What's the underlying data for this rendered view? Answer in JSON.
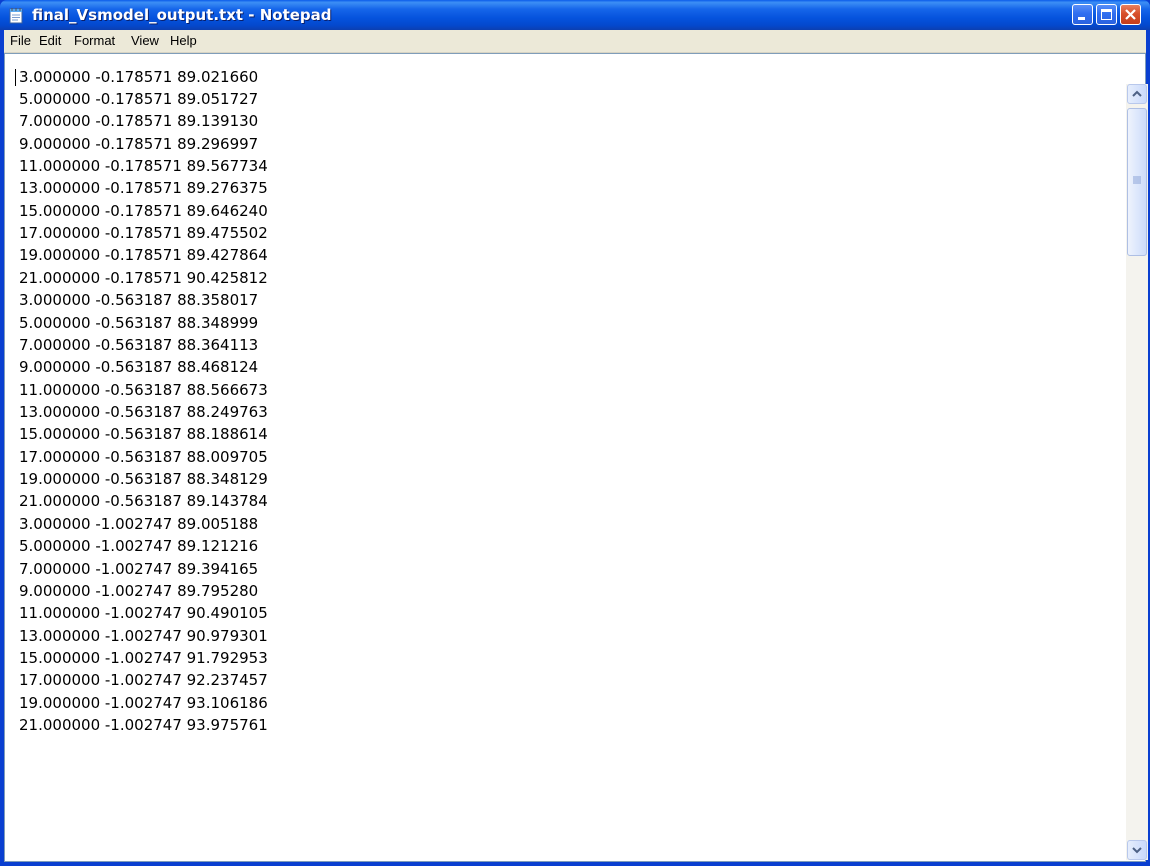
{
  "window": {
    "title": "final_Vsmodel_output.txt - Notepad",
    "icon": "notepad-icon"
  },
  "menu": {
    "file": "File",
    "edit": "Edit",
    "format": "Format",
    "view": "View",
    "help": "Help"
  },
  "document": {
    "lines": [
      "3.000000 -0.178571 89.021660",
      "5.000000 -0.178571 89.051727",
      "7.000000 -0.178571 89.139130",
      "9.000000 -0.178571 89.296997",
      "11.000000 -0.178571 89.567734",
      "13.000000 -0.178571 89.276375",
      "15.000000 -0.178571 89.646240",
      "17.000000 -0.178571 89.475502",
      "19.000000 -0.178571 89.427864",
      "21.000000 -0.178571 90.425812",
      "3.000000 -0.563187 88.358017",
      "5.000000 -0.563187 88.348999",
      "7.000000 -0.563187 88.364113",
      "9.000000 -0.563187 88.468124",
      "11.000000 -0.563187 88.566673",
      "13.000000 -0.563187 88.249763",
      "15.000000 -0.563187 88.188614",
      "17.000000 -0.563187 88.009705",
      "19.000000 -0.563187 88.348129",
      "21.000000 -0.563187 89.143784",
      "3.000000 -1.002747 89.005188",
      "5.000000 -1.002747 89.121216",
      "7.000000 -1.002747 89.394165",
      "9.000000 -1.002747 89.795280",
      "11.000000 -1.002747 90.490105",
      "13.000000 -1.002747 90.979301",
      "15.000000 -1.002747 91.792953",
      "17.000000 -1.002747 92.237457",
      "19.000000 -1.002747 93.106186",
      "21.000000 -1.002747 93.975761"
    ]
  },
  "colors": {
    "titlebar": "#0553dd",
    "close_button": "#d8502c",
    "window_face": "#ece9d8"
  }
}
